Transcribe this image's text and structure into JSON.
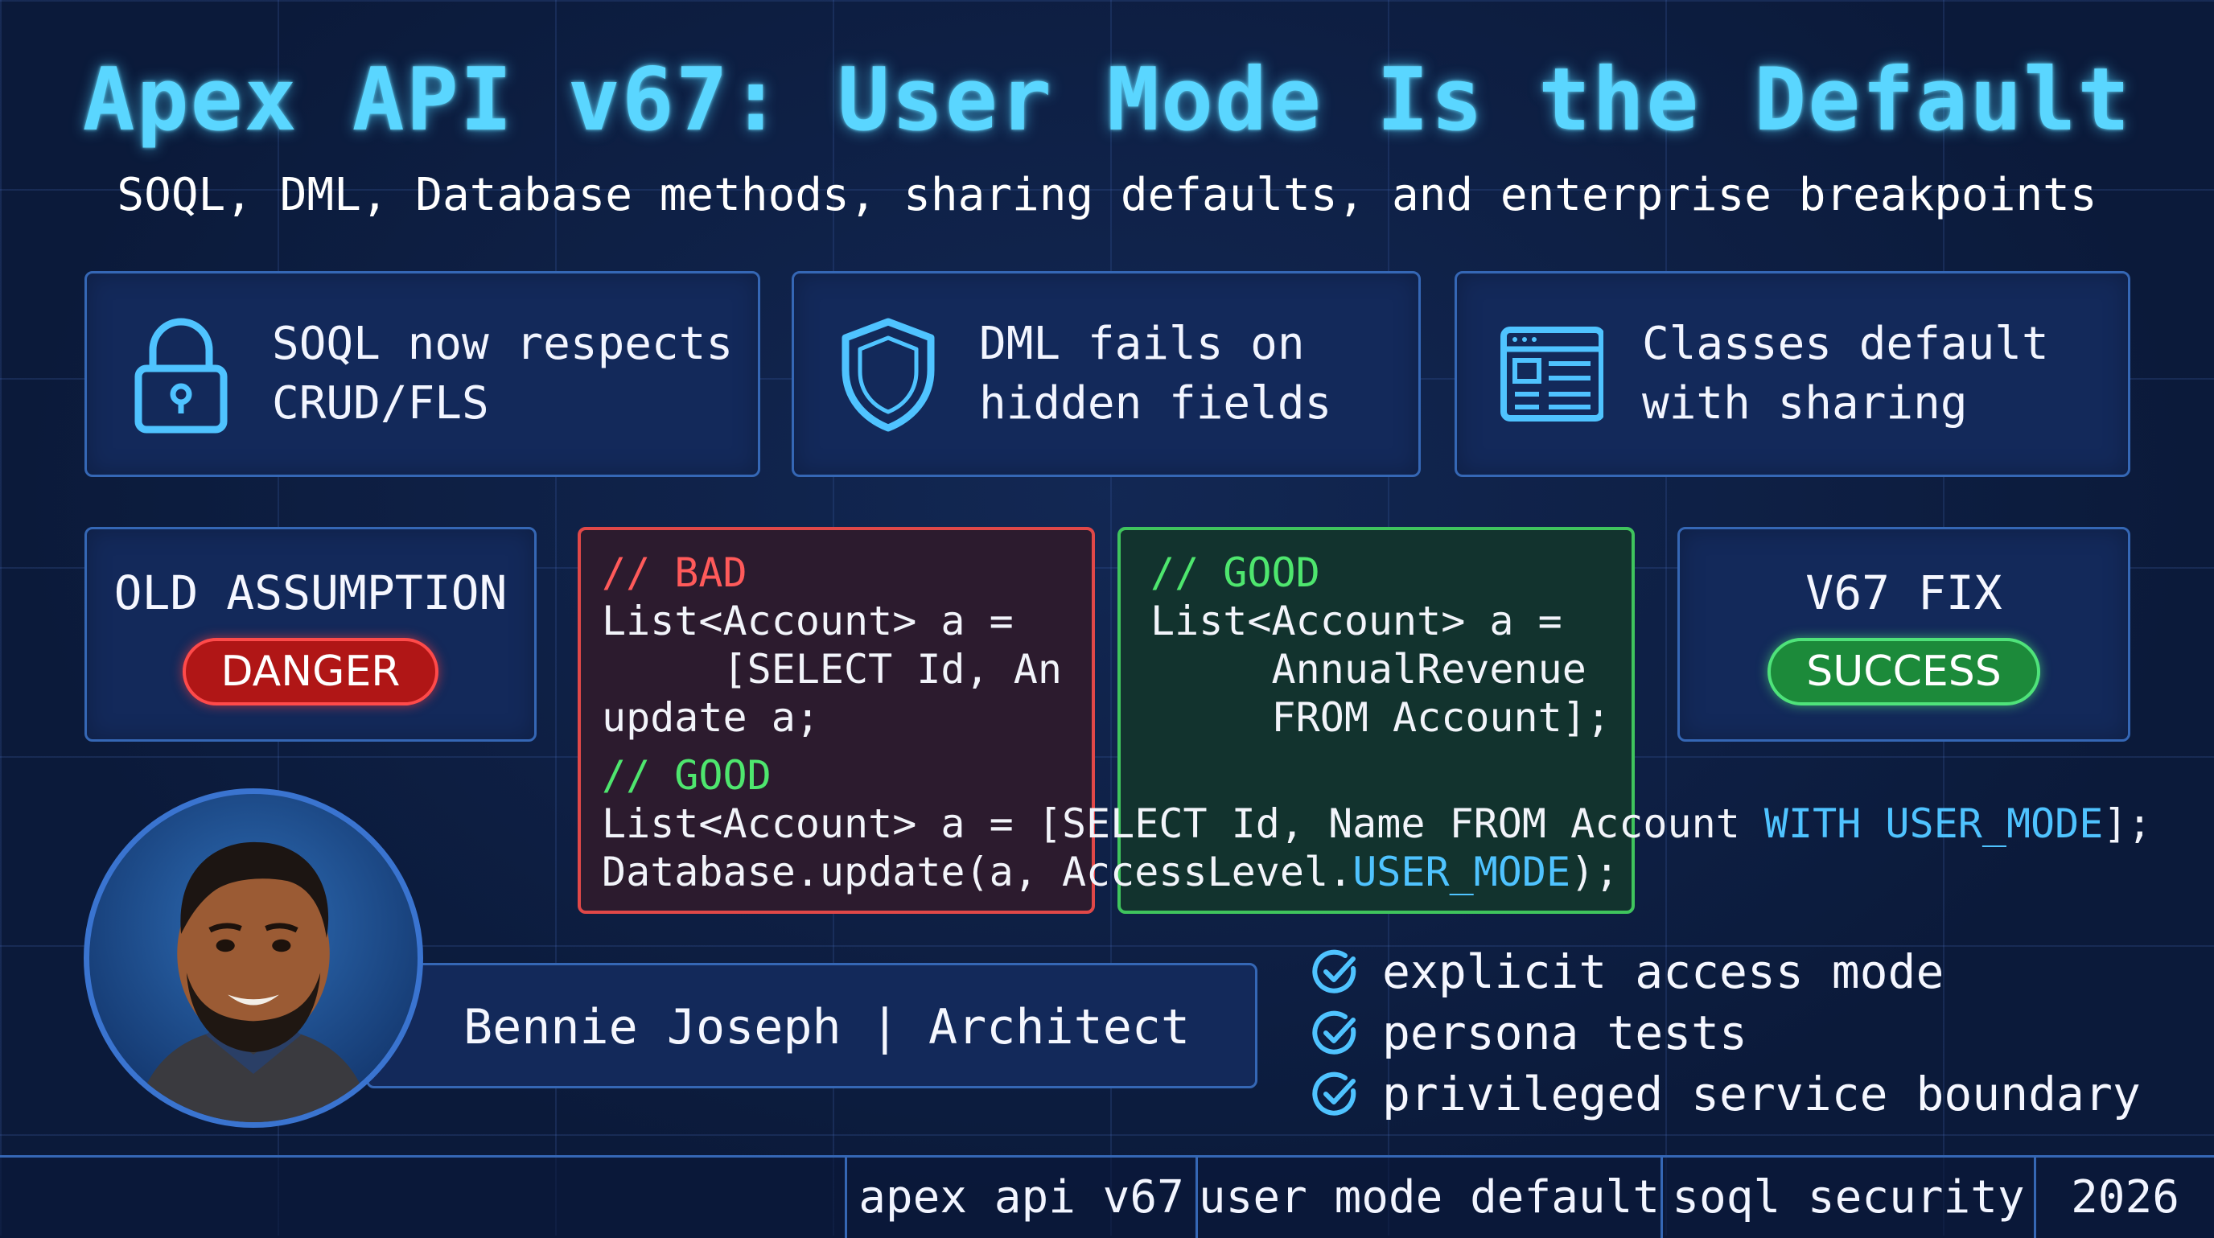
{
  "title": "Apex API v67: User Mode Is the Default",
  "subtitle": "SOQL, DML, Database methods, sharing defaults, and enterprise breakpoints",
  "features": [
    {
      "icon": "lock-icon",
      "text": "SOQL now respects\nCRUD/FLS"
    },
    {
      "icon": "shield-icon",
      "text": "DML fails on\nhidden fields"
    },
    {
      "icon": "layout-icon",
      "text": "Classes default\nwith sharing"
    }
  ],
  "old_assumption": {
    "label": "OLD ASSUMPTION",
    "badge": "DANGER"
  },
  "v67_fix": {
    "label": "V67 FIX",
    "badge": "SUCCESS"
  },
  "code_bad": {
    "comment": "// BAD",
    "line1": "List<Account> a =",
    "line2": "     [SELECT Id, Ann",
    "line3": "update a;"
  },
  "code_good_box": {
    "comment": "// GOOD",
    "line1": "List<Account> a =",
    "line2": "     AnnualRevenue",
    "line3": "     FROM Account];"
  },
  "code_good": {
    "comment": "// GOOD",
    "line1_prefix": "List<Account> a = [SELECT Id, Name FROM Account ",
    "line1_keyword": "WITH USER_MODE",
    "line1_suffix": "];",
    "line2_prefix": "Database.update(a, AccessLevel.",
    "line2_keyword": "USER_MODE",
    "line2_suffix": ");"
  },
  "author": "Bennie Joseph | Architect",
  "checklist": [
    "explicit access mode",
    "persona tests",
    "privileged service boundary"
  ],
  "footer_tags": [
    "apex api v67",
    "user mode default",
    "soql security",
    "2026"
  ],
  "colors": {
    "background": "#0b1a3a",
    "accent": "#5ad6ff",
    "danger": "#b01616",
    "success": "#1c8a3a",
    "keyword": "#4fc3ff"
  }
}
